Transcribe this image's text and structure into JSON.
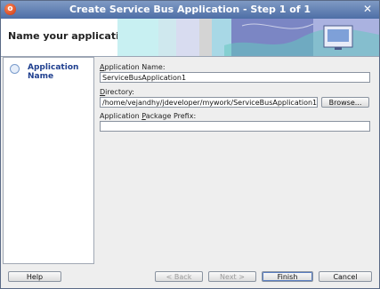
{
  "window": {
    "title": "Create Service Bus Application - Step 1 of 1"
  },
  "banner": {
    "heading": "Name your application"
  },
  "steps": [
    {
      "label": "Application Name"
    }
  ],
  "form": {
    "app_name": {
      "label_mnemonic": "A",
      "label_rest": "pplication Name:",
      "value": "ServiceBusApplication1"
    },
    "directory": {
      "label_mnemonic": "D",
      "label_rest": "irectory:",
      "value": "/home/vejandhy/jdeveloper/mywork/ServiceBusApplication1",
      "browse_label": "Browse..."
    },
    "package_prefix": {
      "label_pre": "Application ",
      "label_mnemonic": "P",
      "label_rest": "ackage Prefix:",
      "value": ""
    }
  },
  "buttons": {
    "help": "Help",
    "back": "< Back",
    "next": "Next >",
    "finish": "Finish",
    "cancel": "Cancel"
  },
  "icons": {
    "app": "oracle-logo-icon",
    "close": "close-icon",
    "step": "step-circle-icon",
    "banner": "wizard-monitor-icon"
  }
}
